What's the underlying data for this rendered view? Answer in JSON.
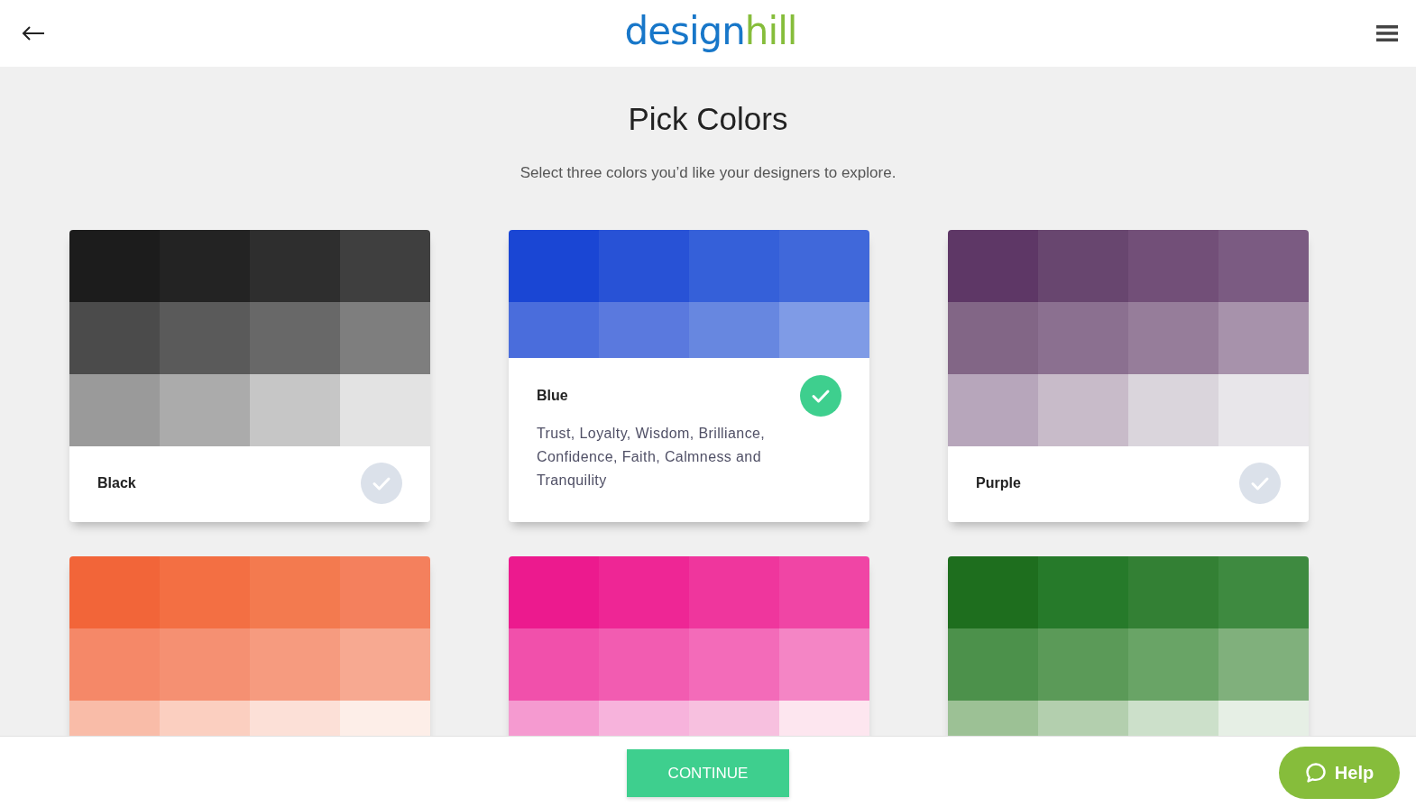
{
  "header": {
    "logo": [
      {
        "text": "design",
        "color": "#1877c9"
      },
      {
        "text": "hill",
        "color": "#86bd3b"
      }
    ]
  },
  "title": "Pick Colors",
  "subtitle": "Select three colors you’d like your designers to explore.",
  "cards": [
    {
      "name": "Black",
      "selected": false,
      "swatches": [
        [
          {
            "color": "#1c1c1c"
          },
          {
            "color": "#232323"
          },
          {
            "color": "#2e2e2e"
          },
          {
            "color": "#3f3f3f"
          }
        ],
        [
          {
            "color": "#4b4b4b"
          },
          {
            "color": "#5a5a5a"
          },
          {
            "color": "#686868"
          },
          {
            "color": "#7e7e7e"
          }
        ],
        [
          {
            "color": "#9a9a9a"
          },
          {
            "color": "#ababab"
          },
          {
            "color": "#c6c6c6"
          },
          {
            "color": "#e3e3e3"
          }
        ]
      ]
    },
    {
      "name": "Blue",
      "selected": true,
      "description": "Trust, Loyalty, Wisdom, Brilliance, Confidence, Faith, Calmness and Tranquility",
      "swatches": [
        [
          {
            "color": "#1a46d4"
          },
          {
            "color": "#2852d6"
          },
          {
            "color": "#3560d9"
          },
          {
            "color": "#4068da"
          }
        ],
        [
          {
            "color": "#4a6ddc"
          },
          {
            "color": "#5a79de"
          },
          {
            "color": "#6787e0"
          },
          {
            "color": "#7f9be6"
          }
        ]
      ]
    },
    {
      "name": "Purple",
      "selected": false,
      "swatches": [
        [
          {
            "color": "#5e3766"
          },
          {
            "color": "#68466f"
          },
          {
            "color": "#724f78"
          },
          {
            "color": "#7b5b82"
          }
        ],
        [
          {
            "color": "#826686"
          },
          {
            "color": "#8b7090"
          },
          {
            "color": "#967d9a"
          },
          {
            "color": "#a792ab"
          }
        ],
        [
          {
            "color": "#b7a6bb"
          },
          {
            "color": "#c8bbc9"
          },
          {
            "color": "#dad5dc"
          },
          {
            "color": "#e8e6ea"
          }
        ]
      ]
    },
    {
      "swatches": [
        [
          {
            "color": "#f26539"
          },
          {
            "color": "#f36f43"
          },
          {
            "color": "#f37a4f"
          },
          {
            "color": "#f4805d"
          }
        ],
        [
          {
            "color": "#f58868"
          },
          {
            "color": "#f59072"
          },
          {
            "color": "#f69b7f"
          },
          {
            "color": "#f7a991"
          }
        ],
        [
          {
            "color": "#f9bca8"
          },
          {
            "color": "#fbcfc0"
          },
          {
            "color": "#fce0d7"
          },
          {
            "color": "#fdeee8"
          }
        ]
      ]
    },
    {
      "swatches": [
        [
          {
            "color": "#ec1a8e"
          },
          {
            "color": "#ee2695"
          },
          {
            "color": "#ef369d"
          },
          {
            "color": "#f045a5"
          }
        ],
        [
          {
            "color": "#f150ab"
          },
          {
            "color": "#f25cb1"
          },
          {
            "color": "#f36bb9"
          },
          {
            "color": "#f485c5"
          }
        ],
        [
          {
            "color": "#f59ad0"
          },
          {
            "color": "#f7b3dc"
          },
          {
            "color": "#f7c0df"
          },
          {
            "color": "#fde6ef"
          }
        ]
      ]
    },
    {
      "swatches": [
        [
          {
            "color": "#1e6e1e"
          },
          {
            "color": "#267a2a"
          },
          {
            "color": "#338034"
          },
          {
            "color": "#3e8a40"
          }
        ],
        [
          {
            "color": "#4c914b"
          },
          {
            "color": "#5b9a58"
          },
          {
            "color": "#69a466"
          },
          {
            "color": "#80b07c"
          }
        ],
        [
          {
            "color": "#9cc195"
          },
          {
            "color": "#b3cfae"
          },
          {
            "color": "#cce0ca"
          },
          {
            "color": "#e6efe5"
          }
        ]
      ]
    }
  ],
  "continue_button": "CONTINUE",
  "help_button": "Help"
}
